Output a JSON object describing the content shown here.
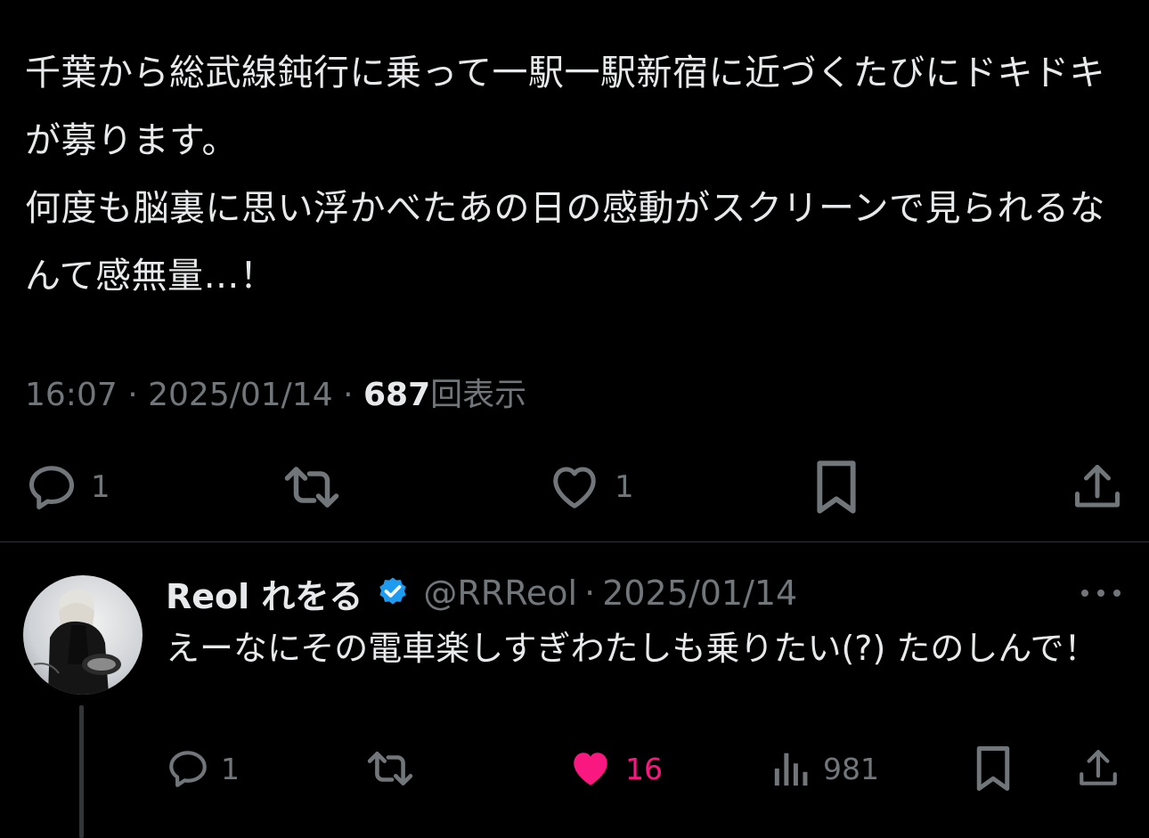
{
  "main_tweet": {
    "text": "千葉から総武線鈍行に乗って一駅一駅新宿に近づくたびにドキドキが募ります。\n何度も脳裏に思い浮かべたあの日の感動がスクリーンで見られるなんて感無量…！",
    "time": "16:07",
    "separator": "·",
    "date": "2025/01/14",
    "views": "687",
    "views_label": "回表示",
    "actions": {
      "reply_icon": "reply-icon",
      "reply_count": "1",
      "retweet_icon": "retweet-icon",
      "like_icon": "heart-outline-icon",
      "like_count": "1",
      "bookmark_icon": "bookmark-icon",
      "share_icon": "share-icon"
    }
  },
  "reply": {
    "display_name": "Reol れをる",
    "verified_icon": "verified-badge-icon",
    "handle": "@RRReol",
    "separator": "·",
    "date": "2025/01/14",
    "text": "えーなにその電車楽しすぎわたしも乗りたい(?) たのしんで！",
    "actions": {
      "reply_count": "1",
      "like_count": "16",
      "liked": true,
      "views_count": "981"
    }
  },
  "colors": {
    "background": "#000000",
    "text_primary": "#e7e9ea",
    "text_secondary": "#71767b",
    "divider": "#2f3336",
    "like_active": "#f91880",
    "verified": "#1d9bf0"
  }
}
